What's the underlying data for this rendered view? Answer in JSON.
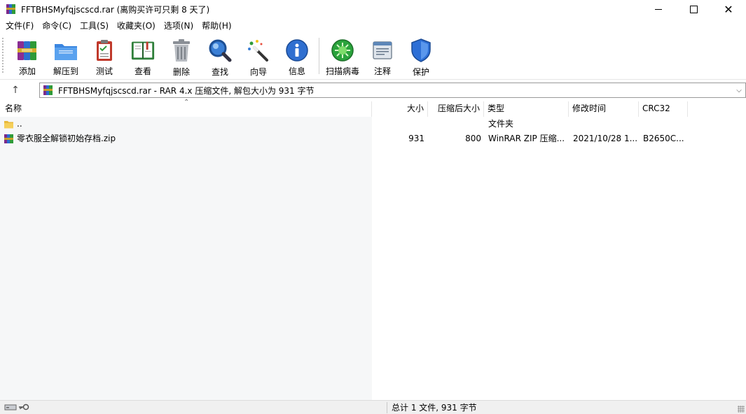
{
  "window": {
    "title": "FFTBHSMyfqjscscd.rar (离购买许可只剩 8 天了)",
    "close_glyph": "✕"
  },
  "menu": [
    "文件(F)",
    "命令(C)",
    "工具(S)",
    "收藏夹(O)",
    "选项(N)",
    "帮助(H)"
  ],
  "toolbar": [
    {
      "label": "添加",
      "icon": "add-books-icon"
    },
    {
      "label": "解压到",
      "icon": "extract-folder-icon"
    },
    {
      "label": "测试",
      "icon": "test-clipboard-icon"
    },
    {
      "label": "查看",
      "icon": "view-book-icon"
    },
    {
      "label": "删除",
      "icon": "trash-icon"
    },
    {
      "label": "查找",
      "icon": "magnifier-icon"
    },
    {
      "label": "向导",
      "icon": "wizard-wand-icon"
    },
    {
      "label": "信息",
      "icon": "info-icon"
    },
    {
      "label": "扫描病毒",
      "icon": "virus-scan-icon"
    },
    {
      "label": "注释",
      "icon": "comment-icon"
    },
    {
      "label": "保护",
      "icon": "shield-icon"
    }
  ],
  "address": {
    "up_glyph": "↑",
    "path": "FFTBHSMyfqjscscd.rar - RAR 4.x 压缩文件, 解包大小为 931 字节",
    "dropdown_glyph": "⌵"
  },
  "columns": {
    "name": "名称",
    "size": "大小",
    "packed": "压缩后大小",
    "type": "类型",
    "modified": "修改时间",
    "crc": "CRC32"
  },
  "files": [
    {
      "name": "..",
      "size": "",
      "packed": "",
      "type": "文件夹",
      "modified": "",
      "crc": "",
      "icon": "folder-icon"
    },
    {
      "name": "零衣服全解锁初始存档.zip",
      "size": "931",
      "packed": "800",
      "type": "WinRAR ZIP 压缩...",
      "modified": "2021/10/28 1...",
      "crc": "B2650C...",
      "icon": "zip-archive-icon"
    }
  ],
  "status": {
    "summary": "总计 1 文件, 931 字节"
  },
  "colors": {
    "accent_blue": "#1c6fd1",
    "list_left_bg": "#f6f7f8"
  }
}
